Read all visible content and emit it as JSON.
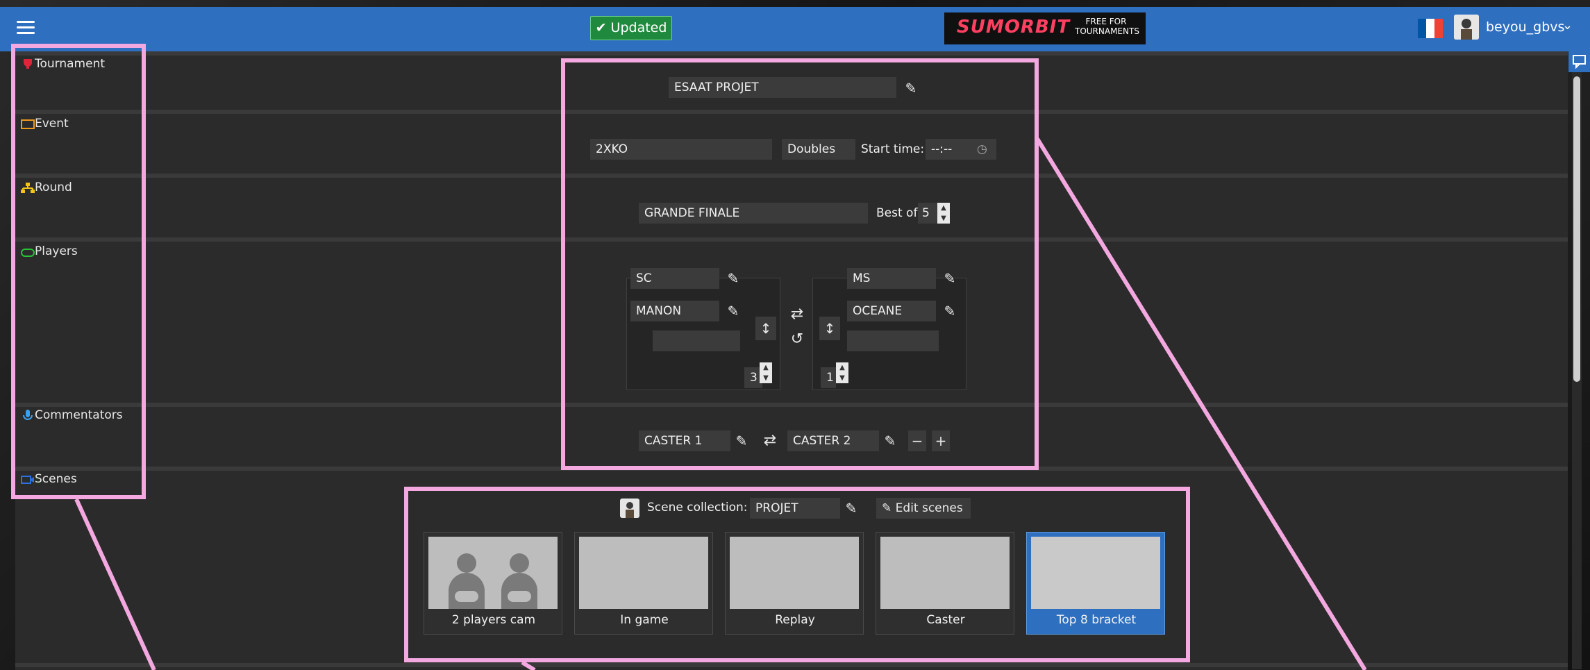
{
  "header": {
    "status_label": "Updated",
    "logo_text": "SUMORBIT",
    "logo_tagline": "FREE FOR TOURNAMENTS",
    "username": "beyou_gbvs",
    "flag_colors": [
      "#0055a4",
      "#ffffff",
      "#ef4135"
    ]
  },
  "sections": {
    "tournament": "Tournament",
    "event": "Event",
    "round": "Round",
    "players": "Players",
    "commentators": "Commentators",
    "scenes": "Scenes"
  },
  "tournament": {
    "name": "ESAAT PROJET"
  },
  "event": {
    "game": "2XKO",
    "format": "Doubles",
    "start_time_label": "Start time:",
    "start_time_value": "--:--"
  },
  "round": {
    "name": "GRANDE FINALE",
    "best_of_label": "Best of",
    "best_of_value": "5"
  },
  "players": {
    "left": {
      "team": "SC",
      "player": "MANON",
      "extra": "",
      "score": "3"
    },
    "right": {
      "team": "MS",
      "player": "OCEANE",
      "extra": "",
      "score": "1"
    }
  },
  "commentators": {
    "caster1": "CASTER 1",
    "caster2": "CASTER 2",
    "minus": "−",
    "plus": "+"
  },
  "scenes": {
    "collection_label": "Scene collection:",
    "collection_value": "PROJET",
    "edit_scenes_label": "Edit scenes",
    "items": [
      {
        "label": "2 players cam"
      },
      {
        "label": "In game"
      },
      {
        "label": "Replay"
      },
      {
        "label": "Caster"
      },
      {
        "label": "Top 8 bracket"
      }
    ]
  },
  "colors": {
    "topbar": "#2f6fc0",
    "accent_pink": "#f4a8e0",
    "updated_green": "#1f8a3d",
    "selected_scene": "#2f6fc0"
  }
}
